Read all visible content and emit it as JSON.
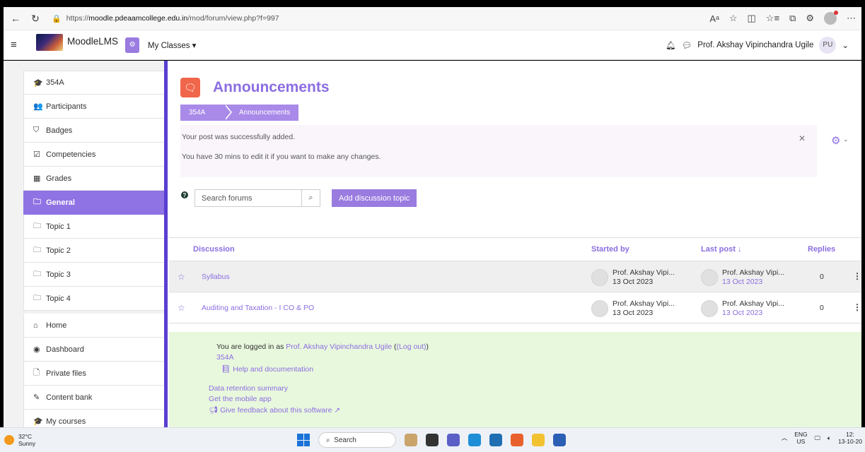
{
  "browser": {
    "url_prefix": "https://",
    "url_host": "moodle.pdeaamcollege.edu.in",
    "url_path": "/mod/forum/view.php?f=997"
  },
  "navbar": {
    "brand": "MoodleLMS",
    "my_classes": "My Classes",
    "user_name": "Prof. Akshay Vipinchandra Ugile",
    "avatar_initials": "PU"
  },
  "sidebar": {
    "items": [
      {
        "label": "354A",
        "icon": "graduation-cap-icon",
        "glyph": "🎓"
      },
      {
        "label": "Participants",
        "icon": "users-icon",
        "glyph": "👥"
      },
      {
        "label": "Badges",
        "icon": "shield-icon",
        "glyph": "⛉"
      },
      {
        "label": "Competencies",
        "icon": "check-square-icon",
        "glyph": "☑"
      },
      {
        "label": "Grades",
        "icon": "table-icon",
        "glyph": "▦"
      },
      {
        "label": "General",
        "icon": "folder-icon",
        "glyph": "🗀"
      },
      {
        "label": "Topic 1",
        "icon": "folder-icon",
        "glyph": "🗀"
      },
      {
        "label": "Topic 2",
        "icon": "folder-icon",
        "glyph": "🗀"
      },
      {
        "label": "Topic 3",
        "icon": "folder-icon",
        "glyph": "🗀"
      },
      {
        "label": "Topic 4",
        "icon": "folder-icon",
        "glyph": "🗀"
      }
    ],
    "items2": [
      {
        "label": "Home",
        "icon": "home-icon",
        "glyph": "⌂"
      },
      {
        "label": "Dashboard",
        "icon": "dashboard-icon",
        "glyph": "◉"
      },
      {
        "label": "Private files",
        "icon": "file-icon",
        "glyph": "🗋"
      },
      {
        "label": "Content bank",
        "icon": "brush-icon",
        "glyph": "✎"
      },
      {
        "label": "My courses",
        "icon": "graduation-cap-icon",
        "glyph": "🎓"
      }
    ],
    "active_index": 5
  },
  "main": {
    "title": "Announcements",
    "breadcrumb": [
      "354A",
      "Announcements"
    ],
    "notice_line1": "Your post was successfully added.",
    "notice_line2": "You have 30 mins to edit it if you want to make any changes.",
    "search_placeholder": "Search forums",
    "add_button": "Add discussion topic"
  },
  "table": {
    "headers": {
      "discussion": "Discussion",
      "started_by": "Started by",
      "last_post": "Last post ↓",
      "replies": "Replies"
    },
    "rows": [
      {
        "title": "Syllabus",
        "starter": "Prof. Akshay Vipi...",
        "start_date": "13 Oct 2023",
        "last_by": "Prof. Akshay Vipi...",
        "last_date": "13 Oct 2023",
        "replies": "0"
      },
      {
        "title": "Auditing and Taxation - I CO & PO",
        "starter": "Prof. Akshay Vipi...",
        "start_date": "13 Oct 2023",
        "last_by": "Prof. Akshay Vipi...",
        "last_date": "13 Oct 2023",
        "replies": "0"
      }
    ]
  },
  "footer": {
    "logged_prefix": "You are logged in as",
    "logged_user": "Prof. Akshay Vipinchandra Ugile",
    "logout": "(Log out)",
    "course": "354A",
    "help": "Help and documentation",
    "data_retention": "Data retention summary",
    "mobile_app": "Get the mobile app",
    "feedback": "Give feedback about this software"
  },
  "taskbar": {
    "temp": "32°C",
    "weather": "Sunny",
    "search": "Search",
    "lang1": "ENG",
    "lang2": "US",
    "time": "12:",
    "date": "13-10-20"
  }
}
